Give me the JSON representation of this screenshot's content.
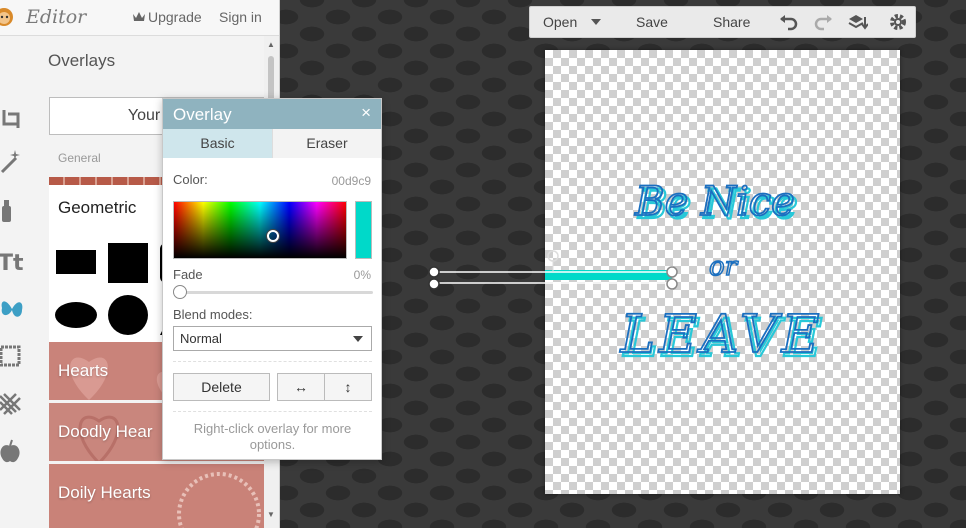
{
  "app": {
    "title": "Editor",
    "upgrade_label": "Upgrade",
    "signin_label": "Sign in"
  },
  "panel": {
    "title": "Overlays",
    "your_overlays_label": "Your Ov",
    "general_label": "General",
    "categories": [
      {
        "label": "Geometric",
        "color": "#ffffff"
      },
      {
        "label": "Hearts",
        "color": "#c9837a"
      },
      {
        "label": "Doodly Hear",
        "color": "#c9867d"
      },
      {
        "label": "Doily Hearts",
        "color": "#c98278"
      }
    ]
  },
  "dialog": {
    "title": "Overlay",
    "close_glyph": "×",
    "tabs": {
      "basic": "Basic",
      "eraser": "Eraser"
    },
    "color_label": "Color:",
    "color_value": "00d9c9",
    "swatch_color": "#00d9c9",
    "fade_label": "Fade",
    "fade_value": "0%",
    "fade_level": 0,
    "blend_label": "Blend modes:",
    "blend_selected": "Normal",
    "delete_label": "Delete",
    "flip_h_glyph": "↔",
    "flip_v_glyph": "↕",
    "hint": "Right-click overlay for more options."
  },
  "toolbar": {
    "open_label": "Open",
    "save_label": "Save",
    "share_label": "Share"
  },
  "canvas": {
    "line1": "Be Nice",
    "line2": "or",
    "line3": "LEAVE",
    "text_color": "#1a6fc0",
    "shadow_color": "#28c8d8",
    "overlay_color": "#00d9c9"
  }
}
